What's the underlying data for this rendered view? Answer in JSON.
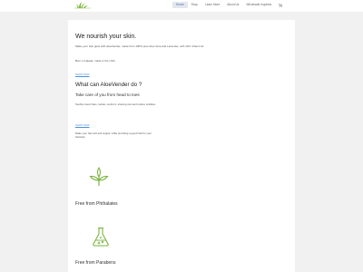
{
  "colors": {
    "accent_green": "#7cb342",
    "link_blue": "#4a8fd8",
    "nav_active": "#4a6fb5",
    "background": "#f1f1f1"
  },
  "header": {
    "logo_icon": "aloe-leaf-logo-icon",
    "nav": {
      "home": "Home",
      "shop": "Shop",
      "learn_more": "Learn More",
      "about_us": "About Us",
      "wholesale": "Wholesale Inquiries"
    },
    "cart_icon": "cart-icon"
  },
  "hero": {
    "title": "We nourish your skin.",
    "text": "Make your skin glow with AloeVender, made from 100% pure Aloe Vera and Lavender, with 1Oil- Vitamin E.",
    "made": "Born in Hawaii, made in the USA."
  },
  "links": {
    "first": "SHOP NOW",
    "second": "SHOP NOW"
  },
  "section": {
    "title": "What can AloeVender do ?",
    "subtitle": "Take care of you from head to toes",
    "text_1": "Soothe insect bites, rashes, sunburn, shaving cuts and reduce wrinkles.",
    "text_2": "Make your hair soft and supple, while providing a good hold for your hairstyle."
  },
  "features": [
    {
      "icon": "leaves-icon",
      "label": "Free from Phthalates"
    },
    {
      "icon": "flask-icon",
      "label": "Free from Parabens"
    }
  ]
}
